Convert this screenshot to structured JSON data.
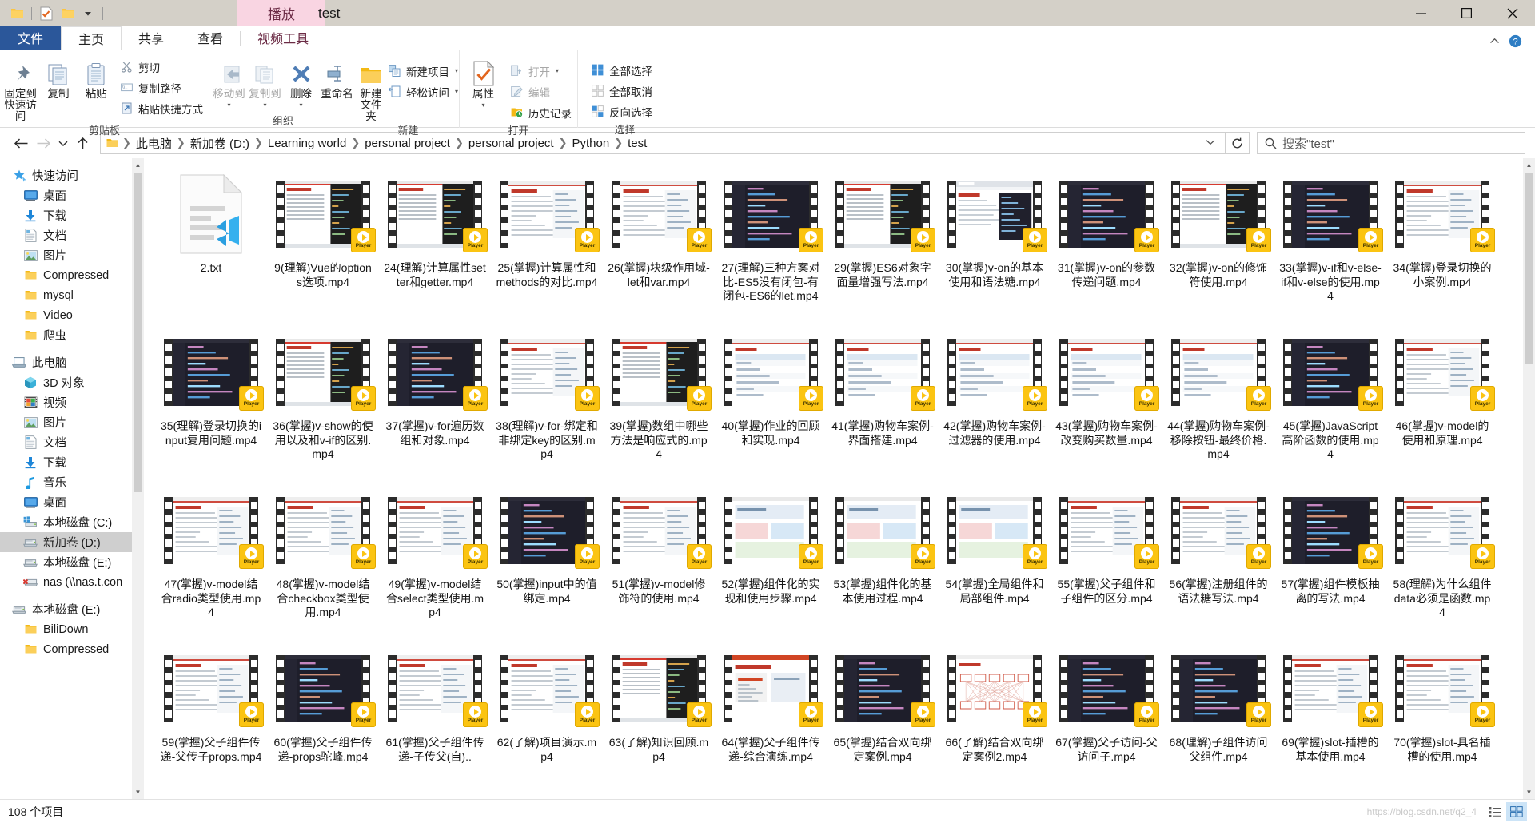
{
  "window": {
    "title": "test",
    "context_tab": "播放",
    "quick_access_icons": [
      "folder-icon",
      "properties-icon",
      "new-folder-icon",
      "customize-caret-icon"
    ],
    "controls": {
      "minimize": "minimize-icon",
      "maximize": "maximize-icon",
      "close": "close-icon"
    }
  },
  "ribbon": {
    "tabs": [
      {
        "label": "文件",
        "kind": "file"
      },
      {
        "label": "主页",
        "kind": "active"
      },
      {
        "label": "共享",
        "kind": "normal"
      },
      {
        "label": "查看",
        "kind": "normal"
      },
      {
        "label": "视频工具",
        "kind": "context"
      }
    ],
    "collapse_label": "^",
    "help_label": "?",
    "groups": [
      {
        "name": "剪贴板",
        "big": [
          {
            "label1": "固定到",
            "label2": "快速访问",
            "icon": "pin-icon",
            "disabled": false
          },
          {
            "label1": "复制",
            "label2": "",
            "icon": "copy-icon",
            "disabled": false
          },
          {
            "label1": "粘贴",
            "label2": "",
            "icon": "paste-icon",
            "disabled": false
          }
        ],
        "small": [
          {
            "label": "剪切",
            "icon": "scissors-icon",
            "disabled": false
          },
          {
            "label": "复制路径",
            "icon": "copy-path-icon",
            "disabled": false
          },
          {
            "label": "粘贴快捷方式",
            "icon": "paste-shortcut-icon",
            "disabled": false
          }
        ]
      },
      {
        "name": "组织",
        "big": [
          {
            "label1": "移动到",
            "label2": "",
            "icon": "move-to-icon",
            "disabled": true,
            "caret": true
          },
          {
            "label1": "复制到",
            "label2": "",
            "icon": "copy-to-icon",
            "disabled": true,
            "caret": true
          },
          {
            "label1": "删除",
            "label2": "",
            "icon": "delete-icon",
            "disabled": false,
            "caret": true
          },
          {
            "label1": "重命名",
            "label2": "",
            "icon": "rename-icon",
            "disabled": false
          }
        ],
        "small": []
      },
      {
        "name": "新建",
        "big": [
          {
            "label1": "新建",
            "label2": "文件夹",
            "icon": "new-folder-icon",
            "disabled": false
          }
        ],
        "small": [
          {
            "label": "新建项目",
            "icon": "new-item-icon",
            "disabled": false,
            "caret": true
          },
          {
            "label": "轻松访问",
            "icon": "easy-access-icon",
            "disabled": false,
            "caret": true
          }
        ]
      },
      {
        "name": "打开",
        "big": [
          {
            "label1": "属性",
            "label2": "",
            "icon": "properties-icon",
            "disabled": false,
            "caret": true
          }
        ],
        "small": [
          {
            "label": "打开",
            "icon": "open-icon",
            "disabled": true,
            "caret": true
          },
          {
            "label": "编辑",
            "icon": "edit-icon",
            "disabled": true
          },
          {
            "label": "历史记录",
            "icon": "history-icon",
            "disabled": false
          }
        ]
      },
      {
        "name": "选择",
        "big": [],
        "small": [
          {
            "label": "全部选择",
            "icon": "select-all-icon",
            "disabled": false
          },
          {
            "label": "全部取消",
            "icon": "select-none-icon",
            "disabled": false
          },
          {
            "label": "反向选择",
            "icon": "invert-selection-icon",
            "disabled": false
          }
        ]
      }
    ]
  },
  "address": {
    "back_icon": "back-arrow-icon",
    "forward_icon": "forward-arrow-icon",
    "recent_icon": "recent-caret-icon",
    "up_icon": "up-arrow-icon",
    "folder_icon": "folder-icon",
    "crumbs": [
      "此电脑",
      "新加卷 (D:)",
      "Learning world",
      "personal project",
      "personal project",
      "Python",
      "test"
    ],
    "dropdown_icon": "chevron-down-icon",
    "refresh_icon": "refresh-icon",
    "search_placeholder": "搜索\"test\"",
    "search_icon": "search-icon"
  },
  "sidebar": {
    "groups": [
      {
        "header": {
          "label": "快速访问",
          "icon": "star-pin-icon",
          "indent": 14
        },
        "items": [
          {
            "label": "桌面",
            "icon": "desktop-icon",
            "pinned": true,
            "indent": 28
          },
          {
            "label": "下载",
            "icon": "download-icon",
            "pinned": true,
            "indent": 28
          },
          {
            "label": "文档",
            "icon": "documents-icon",
            "pinned": true,
            "indent": 28
          },
          {
            "label": "图片",
            "icon": "pictures-icon",
            "pinned": true,
            "indent": 28
          },
          {
            "label": "Compressed",
            "icon": "folder-icon",
            "pinned": false,
            "indent": 28
          },
          {
            "label": "mysql",
            "icon": "folder-icon",
            "pinned": false,
            "indent": 28
          },
          {
            "label": "Video",
            "icon": "folder-icon",
            "pinned": false,
            "indent": 28
          },
          {
            "label": "爬虫",
            "icon": "folder-icon",
            "pinned": false,
            "indent": 28
          }
        ]
      },
      {
        "header": {
          "label": "此电脑",
          "icon": "computer-icon",
          "indent": 14
        },
        "items": [
          {
            "label": "3D 对象",
            "icon": "3d-objects-icon",
            "pinned": false,
            "indent": 28
          },
          {
            "label": "视频",
            "icon": "videos-icon",
            "pinned": false,
            "indent": 28
          },
          {
            "label": "图片",
            "icon": "pictures-icon",
            "pinned": false,
            "indent": 28
          },
          {
            "label": "文档",
            "icon": "documents-icon",
            "pinned": false,
            "indent": 28
          },
          {
            "label": "下载",
            "icon": "download-icon",
            "pinned": false,
            "indent": 28
          },
          {
            "label": "音乐",
            "icon": "music-icon",
            "pinned": false,
            "indent": 28
          },
          {
            "label": "桌面",
            "icon": "desktop-icon",
            "pinned": false,
            "indent": 28
          },
          {
            "label": "本地磁盘 (C:)",
            "icon": "system-drive-icon",
            "pinned": false,
            "indent": 28
          },
          {
            "label": "新加卷 (D:)",
            "icon": "drive-icon",
            "pinned": false,
            "indent": 28,
            "selected": true
          },
          {
            "label": "本地磁盘 (E:)",
            "icon": "drive-icon",
            "pinned": false,
            "indent": 28
          },
          {
            "label": "nas (\\\\nas.t.con",
            "icon": "network-drive-error-icon",
            "pinned": false,
            "indent": 28
          }
        ]
      },
      {
        "header": {
          "label": "本地磁盘 (E:)",
          "icon": "drive-icon",
          "indent": 14
        },
        "items": [
          {
            "label": "BiliDown",
            "icon": "folder-icon",
            "pinned": false,
            "indent": 28
          },
          {
            "label": "Compressed",
            "icon": "folder-icon",
            "pinned": false,
            "indent": 28
          }
        ]
      }
    ]
  },
  "files": [
    {
      "name": "2.txt",
      "type": "txt",
      "overlay": "vscode"
    },
    {
      "name": "9(理解)Vue的options选项.mp4",
      "type": "video",
      "shot": "doc-dark"
    },
    {
      "name": "24(理解)计算属性setter和getter.mp4",
      "type": "video",
      "shot": "doc-dark"
    },
    {
      "name": "25(掌握)计算属性和methods的对比.mp4",
      "type": "video",
      "shot": "doc-light"
    },
    {
      "name": "26(掌握)块级作用域-let和var.mp4",
      "type": "video",
      "shot": "doc-light"
    },
    {
      "name": "27(理解)三种方案对比-ES5没有闭包-有闭包-ES6的let.mp4",
      "type": "video",
      "shot": "code-dark"
    },
    {
      "name": "29(掌握)ES6对象字面量增强写法.mp4",
      "type": "video",
      "shot": "doc-dark"
    },
    {
      "name": "30(掌握)v-on的基本使用和语法糖.mp4",
      "type": "video",
      "shot": "browser"
    },
    {
      "name": "31(掌握)v-on的参数传递问题.mp4",
      "type": "video",
      "shot": "code-dark"
    },
    {
      "name": "32(掌握)v-on的修饰符使用.mp4",
      "type": "video",
      "shot": "doc-dark"
    },
    {
      "name": "33(掌握)v-if和v-else-if和v-else的使用.mp4",
      "type": "video",
      "shot": "code-dark"
    },
    {
      "name": "34(掌握)登录切换的小案例.mp4",
      "type": "video",
      "shot": "doc-light"
    },
    {
      "name": "35(理解)登录切换的input复用问题.mp4",
      "type": "video",
      "shot": "code-dark"
    },
    {
      "name": "36(掌握)v-show的使用以及和v-if的区别.mp4",
      "type": "video",
      "shot": "doc-dark"
    },
    {
      "name": "37(掌握)v-for遍历数组和对象.mp4",
      "type": "video",
      "shot": "code-dark"
    },
    {
      "name": "38(理解)v-for-绑定和非绑定key的区别.mp4",
      "type": "video",
      "shot": "doc-light"
    },
    {
      "name": "39(掌握)数组中哪些方法是响应式的.mp4",
      "type": "video",
      "shot": "doc-dark"
    },
    {
      "name": "40(掌握)作业的回顾和实现.mp4",
      "type": "video",
      "shot": "table"
    },
    {
      "name": "41(掌握)购物车案例-界面搭建.mp4",
      "type": "video",
      "shot": "table"
    },
    {
      "name": "42(掌握)购物车案例-过滤器的使用.mp4",
      "type": "video",
      "shot": "table"
    },
    {
      "name": "43(掌握)购物车案例-改变购买数量.mp4",
      "type": "video",
      "shot": "table"
    },
    {
      "name": "44(掌握)购物车案例-移除按钮-最终价格.mp4",
      "type": "video",
      "shot": "table"
    },
    {
      "name": "45(掌握)JavaScript高阶函数的使用.mp4",
      "type": "video",
      "shot": "code-dark"
    },
    {
      "name": "46(掌握)v-model的使用和原理.mp4",
      "type": "video",
      "shot": "doc-light"
    },
    {
      "name": "47(掌握)v-model结合radio类型使用.mp4",
      "type": "video",
      "shot": "doc-light"
    },
    {
      "name": "48(掌握)v-model结合checkbox类型使用.mp4",
      "type": "video",
      "shot": "doc-light"
    },
    {
      "name": "49(掌握)v-model结合select类型使用.mp4",
      "type": "video",
      "shot": "doc-light"
    },
    {
      "name": "50(掌握)input中的值绑定.mp4",
      "type": "video",
      "shot": "code-dark"
    },
    {
      "name": "51(掌握)v-model修饰符的使用.mp4",
      "type": "video",
      "shot": "doc-light"
    },
    {
      "name": "52(掌握)组件化的实现和使用步骤.mp4",
      "type": "video",
      "shot": "slides"
    },
    {
      "name": "53(掌握)组件化的基本使用过程.mp4",
      "type": "video",
      "shot": "slides"
    },
    {
      "name": "54(掌握)全局组件和局部组件.mp4",
      "type": "video",
      "shot": "slides"
    },
    {
      "name": "55(掌握)父子组件和子组件的区分.mp4",
      "type": "video",
      "shot": "doc-light"
    },
    {
      "name": "56(掌握)注册组件的语法糖写法.mp4",
      "type": "video",
      "shot": "doc-light"
    },
    {
      "name": "57(掌握)组件模板抽离的写法.mp4",
      "type": "video",
      "shot": "code-dark"
    },
    {
      "name": "58(理解)为什么组件data必须是函数.mp4",
      "type": "video",
      "shot": "doc-light"
    },
    {
      "name": "59(掌握)父子组件传递-父传子props.mp4",
      "type": "video",
      "shot": "doc-light"
    },
    {
      "name": "60(掌握)父子组件传递-props驼峰.mp4",
      "type": "video",
      "shot": "code-dark"
    },
    {
      "name": "61(掌握)父子组件传递-子传父(自)..",
      "type": "video",
      "shot": "doc-light"
    },
    {
      "name": "62(了解)项目演示.mp4",
      "type": "video",
      "shot": "doc-light"
    },
    {
      "name": "63(了解)知识回顾.mp4",
      "type": "video",
      "shot": "doc-dark"
    },
    {
      "name": "64(掌握)父子组件传递-综合演练.mp4",
      "type": "video",
      "shot": "ppt"
    },
    {
      "name": "65(掌握)结合双向绑定案例.mp4",
      "type": "video",
      "shot": "code-dark"
    },
    {
      "name": "66(了解)结合双向绑定案例2.mp4",
      "type": "video",
      "shot": "diagram"
    },
    {
      "name": "67(掌握)父子访问-父访问子.mp4",
      "type": "video",
      "shot": "code-dark"
    },
    {
      "name": "68(理解)子组件访问父组件.mp4",
      "type": "video",
      "shot": "code-dark"
    },
    {
      "name": "69(掌握)slot-插槽的基本使用.mp4",
      "type": "video",
      "shot": "doc-light"
    },
    {
      "name": "70(掌握)slot-具名插槽的使用.mp4",
      "type": "video",
      "shot": "doc-light"
    }
  ],
  "status": {
    "item_count": "108 个项目",
    "watermark": "https://blog.csdn.net/q2_4",
    "views": [
      {
        "name": "details-view",
        "active": false
      },
      {
        "name": "large-icons-view",
        "active": true
      }
    ]
  },
  "colors": {
    "accent": "#2b579a",
    "context_tab": "#f9d5e2",
    "player_badge": "#fbc412",
    "selection": "#cfcfcf"
  }
}
